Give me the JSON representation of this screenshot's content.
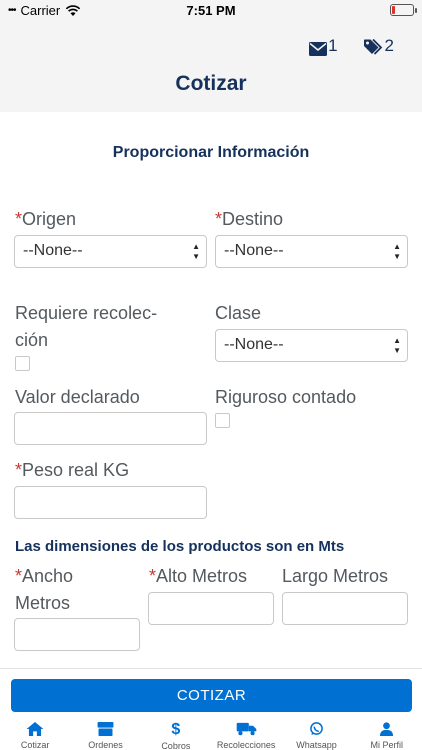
{
  "status": {
    "carrier": "Carrier",
    "time": "7:51 PM"
  },
  "header": {
    "title": "Cotizar",
    "mail_count": "1",
    "tag_count": "2"
  },
  "form": {
    "section_title": "Proporcionar Información",
    "required_mark": "*",
    "origen": {
      "label": "Origen",
      "value": "--None--"
    },
    "destino": {
      "label": "Destino",
      "value": "--None--"
    },
    "recoleccion": {
      "label_line1": "Requiere recolec-",
      "label_line2": "ción"
    },
    "clase": {
      "label": "Clase",
      "value": "--None--"
    },
    "valor": {
      "label": "Valor declarado"
    },
    "riguroso": {
      "label": "Riguroso contado"
    },
    "peso": {
      "label": "Peso real KG"
    },
    "dimensions_heading": "Las dimensiones de los productos son en Mts",
    "ancho": {
      "label_line1": "Ancho",
      "label_line2": "Metros"
    },
    "alto": {
      "label": "Alto Metros"
    },
    "largo": {
      "label": "Largo Metros"
    }
  },
  "cta": {
    "label": "COTIZAR"
  },
  "tabs": [
    {
      "icon": "home-icon",
      "label": "Cotizar"
    },
    {
      "icon": "box-icon",
      "label": "Ordenes"
    },
    {
      "icon": "dollar-icon",
      "label": "Cobros"
    },
    {
      "icon": "truck-icon",
      "label": "Recolecciones"
    },
    {
      "icon": "whatsapp-icon",
      "label": "Whatsapp"
    },
    {
      "icon": "user-icon",
      "label": "Mi Perfil"
    }
  ],
  "colors": {
    "accent": "#0070d2",
    "navy": "#16325c",
    "required": "#c23934"
  }
}
